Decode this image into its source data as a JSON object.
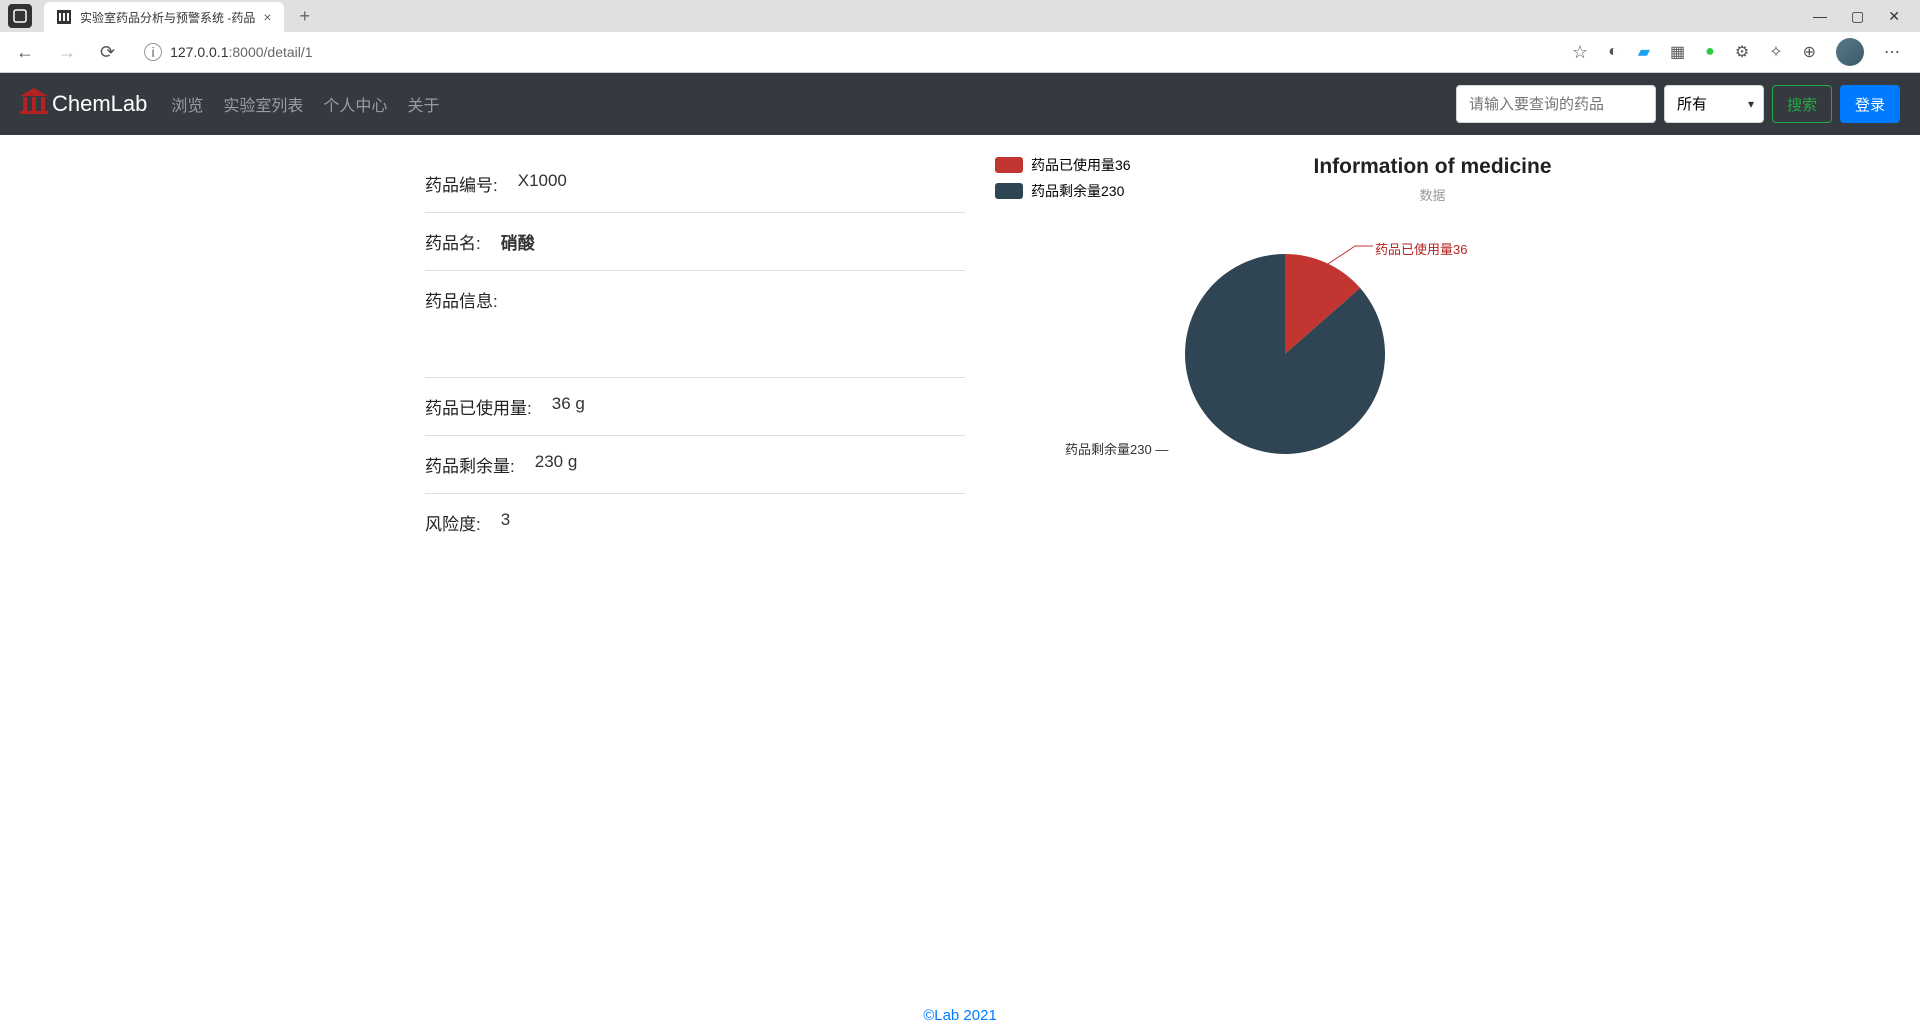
{
  "browser": {
    "tab_title": "实验室药品分析与预警系统 -药品",
    "url_host": "127.0.0.1",
    "url_port_path": ":8000/detail/1"
  },
  "navbar": {
    "brand": "ChemLab",
    "links": [
      "浏览",
      "实验室列表",
      "个人中心",
      "关于"
    ],
    "search_placeholder": "请输入要查询的药品",
    "select_value": "所有",
    "search_btn": "搜索",
    "login_btn": "登录"
  },
  "detail": {
    "rows": [
      {
        "label": "药品编号:",
        "value": "X1000",
        "bold": false
      },
      {
        "label": "药品名:",
        "value": "硝酸",
        "bold": true
      },
      {
        "label": "药品信息:",
        "value": "",
        "bold": false
      }
    ],
    "rows2": [
      {
        "label": "药品已使用量:",
        "value": "36 g"
      },
      {
        "label": "药品剩余量:",
        "value": "230 g"
      },
      {
        "label": "风险度:",
        "value": "3"
      }
    ]
  },
  "chart_data": {
    "type": "pie",
    "title": "Information of medicine",
    "subtitle": "数据",
    "series": [
      {
        "name": "药品已使用量36",
        "value": 36,
        "color": "#c23531"
      },
      {
        "name": "药品剩余量230",
        "value": 230,
        "color": "#2f4554"
      }
    ]
  },
  "footer": {
    "text": "©Lab 2021"
  }
}
